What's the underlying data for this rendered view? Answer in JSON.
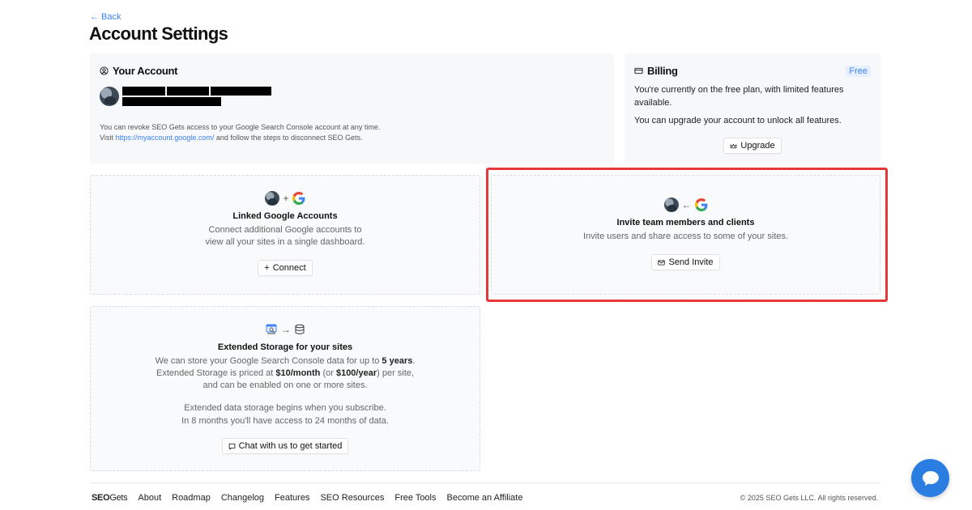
{
  "nav": {
    "back_label": "← Back"
  },
  "page": {
    "title": "Account Settings"
  },
  "account": {
    "title": "Your Account",
    "note_line1": "You can revoke SEO Gets access to your Google Search Console account at any time.",
    "note_prefix": "Visit ",
    "note_link": "https://myaccount.google.com/",
    "note_suffix": " and follow the steps to disconnect SEO Gets."
  },
  "billing": {
    "title": "Billing",
    "badge": "Free",
    "line1": "You're currently on the free plan, with limited features available.",
    "line2": "You can upgrade your account to unlock all features.",
    "upgrade_label": "Upgrade"
  },
  "linked": {
    "title": "Linked Google Accounts",
    "desc_line1": "Connect additional Google accounts to",
    "desc_line2": "view all your sites in a single dashboard.",
    "connect_label": "Connect"
  },
  "invite": {
    "title": "Invite team members and clients",
    "desc": "Invite users and share access to some of your sites.",
    "button_label": "Send Invite"
  },
  "storage": {
    "title": "Extended Storage for your sites",
    "l1_pre": "We can store your Google Search Console data for up to ",
    "l1_bold": "5 years",
    "l1_post": ".",
    "l2_pre": "Extended Storage is priced at ",
    "l2_bold1": "$10/month",
    "l2_mid": " (or ",
    "l2_bold2": "$100/year",
    "l2_post": ") per site,",
    "l3": "and can be enabled on one or more sites.",
    "l4": "Extended data storage begins when you subscribe.",
    "l5": "In 8 months you'll have access to 24 months of data.",
    "chat_label": "Chat with us to get started"
  },
  "footer": {
    "logo_seo": "SEO",
    "logo_gets": "Gets",
    "links": [
      "About",
      "Roadmap",
      "Changelog",
      "Features",
      "SEO Resources",
      "Free Tools",
      "Become an Affiliate"
    ],
    "copyright": "© 2025 SEO Gets LLC. All rights reserved."
  },
  "colors": {
    "accent": "#3b82f6",
    "highlight": "#e5383b",
    "chat": "#2a7de1"
  },
  "icons": {
    "account": "user-circle-icon",
    "billing": "credit-card-icon",
    "upgrade": "crown-icon",
    "connect": "plus-icon",
    "invite": "mail-icon",
    "chat": "message-icon",
    "storage": "database-icon",
    "google": "google-icon",
    "messenger": "chat-bubble-icon"
  }
}
